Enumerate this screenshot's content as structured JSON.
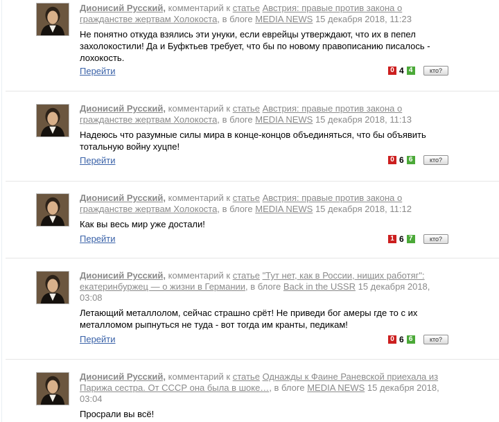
{
  "comments": [
    {
      "author": "Дионисий Русский,",
      "comment_label": "комментарий к",
      "article_label": "статье",
      "article_title": "Австрия: правые против закона о гражданстве жертвам Холокоста",
      "blog_label": ", в блоге",
      "blog_name": "MEDIA NEWS",
      "date": "15 декабря 2018, 11:23",
      "text": "Не понятно откуда взялись эти унуки, если еврейцы утверждают, что их в пепел захолокостили! Да и Буфктьев требует, что бы по новому правописанию писалось - лохокость.",
      "goto": "Перейти",
      "votes": {
        "minus": "0",
        "total": "4",
        "plus": "4"
      },
      "who": "кто?"
    },
    {
      "author": "Дионисий Русский,",
      "comment_label": "комментарий к",
      "article_label": "статье",
      "article_title": "Австрия: правые против закона о гражданстве жертвам Холокоста",
      "blog_label": ", в блоге",
      "blog_name": "MEDIA NEWS",
      "date": "15 декабря 2018, 11:13",
      "text": "Надеюсь что разумные силы мира в конце-концов объединяться, что бы объявить тотальную войну хуцпе!",
      "goto": "Перейти",
      "votes": {
        "minus": "0",
        "total": "6",
        "plus": "6"
      },
      "who": "кто?"
    },
    {
      "author": "Дионисий Русский,",
      "comment_label": "комментарий к",
      "article_label": "статье",
      "article_title": "Австрия: правые против закона о гражданстве жертвам Холокоста",
      "blog_label": ", в блоге",
      "blog_name": "MEDIA NEWS",
      "date": "15 декабря 2018, 11:12",
      "text": "Как вы весь мир уже достали!",
      "goto": "Перейти",
      "votes": {
        "minus": "1",
        "total": "6",
        "plus": "7"
      },
      "who": "кто?"
    },
    {
      "author": "Дионисий Русский,",
      "comment_label": "комментарий к",
      "article_label": "статье",
      "article_title": "\"Тут нет, как в России, нищих работяг\": екатеринбуржец — о жизни в Германии",
      "blog_label": ", в блоге",
      "blog_name": "Back in the USSR",
      "date": "15 декабря 2018, 03:08",
      "text": "Летающий металлолом, сейчас страшно срёт! Не приведи бог амеры где то с их металломом рыпнуться не туда - вот тогда им кранты, педикам!",
      "goto": "Перейти",
      "votes": {
        "minus": "0",
        "total": "6",
        "plus": "6"
      },
      "who": "кто?"
    },
    {
      "author": "Дионисий Русский,",
      "comment_label": "комментарий к",
      "article_label": "статье",
      "article_title": "Однажды к Фаине Раневской приехала из Парижа сестра. От СССР она была в шоке…",
      "blog_label": ", в блоге",
      "blog_name": "MEDIA NEWS",
      "date": "15 декабря 2018, 03:04",
      "text": "Просрали вы всё!",
      "goto": "",
      "votes": {
        "minus": "",
        "total": "",
        "plus": ""
      },
      "who": ""
    }
  ]
}
